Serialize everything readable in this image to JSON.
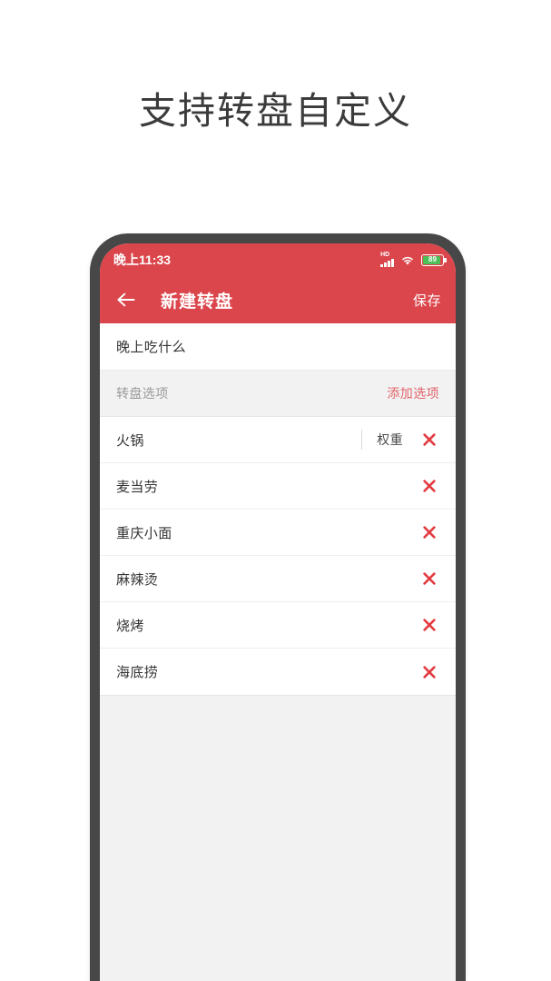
{
  "headline": "支持转盘自定义",
  "phone": {
    "statusbar": {
      "time": "晚上11:33",
      "network_label": "HD",
      "battery_percent": "89",
      "signal_icon": "signal-bars-icon",
      "wifi_icon": "wifi-icon",
      "battery_icon": "battery-icon"
    },
    "appbar": {
      "back_icon": "back-arrow-icon",
      "title": "新建转盘",
      "save_label": "保存",
      "background_color": "#db464c"
    },
    "form": {
      "wheel_title_value": "晚上吃什么",
      "wheel_title_placeholder": "请输入转盘名称",
      "section_label": "转盘选项",
      "add_option_label": "添加选项",
      "add_option_color": "#e2636b"
    },
    "options": [
      {
        "name": "火锅",
        "weight_label": "权重",
        "show_weight": true,
        "delete_icon": "close-icon"
      },
      {
        "name": "麦当劳",
        "weight_label": "",
        "show_weight": false,
        "delete_icon": "close-icon"
      },
      {
        "name": "重庆小面",
        "weight_label": "",
        "show_weight": false,
        "delete_icon": "close-icon"
      },
      {
        "name": "麻辣烫",
        "weight_label": "",
        "show_weight": false,
        "delete_icon": "close-icon"
      },
      {
        "name": "烧烤",
        "weight_label": "",
        "show_weight": false,
        "delete_icon": "close-icon"
      },
      {
        "name": "海底捞",
        "weight_label": "",
        "show_weight": false,
        "delete_icon": "close-icon"
      }
    ],
    "colors": {
      "accent_red": "#db464c",
      "delete_red": "#e23b40",
      "bezel": "#474747",
      "screen_bg": "#f2f2f2",
      "battery_green": "#4bbf58"
    }
  }
}
